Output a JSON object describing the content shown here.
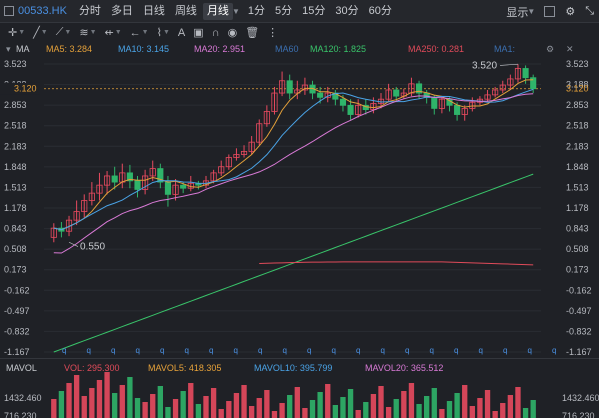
{
  "topbar": {
    "code": "00533.HK",
    "tabs": [
      "分时",
      "多日",
      "日线",
      "周线",
      "月线",
      "1分",
      "5分",
      "15分",
      "30分",
      "60分"
    ],
    "active_tab": "月线",
    "display_label": "显示"
  },
  "ma_legend": {
    "label": "MA",
    "items": [
      {
        "text": "MA5: 3.284",
        "color": "#e3a03a"
      },
      {
        "text": "MA10: 3.145",
        "color": "#4aa3e6"
      },
      {
        "text": "MA20: 2.951",
        "color": "#d97ad6"
      },
      {
        "text": "MA60",
        "color": "#3b6fb0"
      },
      {
        "text": "MA120: 1.825",
        "color": "#39c46a"
      },
      {
        "text": "MA250: 0.281",
        "color": "#e04b5a"
      },
      {
        "text": "MA1:",
        "color": "#3b6fb0"
      }
    ]
  },
  "price_axis": {
    "ticks": [
      "3.523",
      "3.188",
      "2.853",
      "2.518",
      "2.183",
      "1.848",
      "1.513",
      "1.178",
      "0.843",
      "0.508",
      "0.173",
      "-0.162",
      "-0.497",
      "-0.832",
      "-1.167"
    ],
    "current_price": "3.120",
    "high_label": "3.520",
    "low_label": "0.550",
    "colors": {
      "up": "#e84a5f",
      "down": "#2fb46a",
      "current": "#e8a33a"
    }
  },
  "vol_legend": {
    "label": "MAVOL",
    "items": [
      {
        "text": "VOL: 295.300",
        "color": "#e04b5a"
      },
      {
        "text": "MAVOL5: 418.305",
        "color": "#e8a33a"
      },
      {
        "text": "MAVOL10: 395.799",
        "color": "#4aa3e6"
      },
      {
        "text": "MAVOL20: 365.512",
        "color": "#d97ad6"
      }
    ],
    "axis_ticks": [
      "1432.460",
      "716.230"
    ]
  },
  "chart_data": {
    "type": "candlestick",
    "ylim": [
      -1.167,
      3.523
    ],
    "candles": [
      [
        0.7,
        0.85,
        0.93,
        0.62
      ],
      [
        0.85,
        0.8,
        0.95,
        0.7
      ],
      [
        0.8,
        0.98,
        1.05,
        0.72
      ],
      [
        0.98,
        1.12,
        1.3,
        0.9
      ],
      [
        1.12,
        1.3,
        1.4,
        1.02
      ],
      [
        1.3,
        1.42,
        1.6,
        1.22
      ],
      [
        1.42,
        1.55,
        1.75,
        1.3
      ],
      [
        1.55,
        1.7,
        1.78,
        1.4
      ],
      [
        1.7,
        1.6,
        1.85,
        1.48
      ],
      [
        1.6,
        1.75,
        1.9,
        1.5
      ],
      [
        1.75,
        1.62,
        1.88,
        1.5
      ],
      [
        1.62,
        1.48,
        1.7,
        1.35
      ],
      [
        1.48,
        1.7,
        1.8,
        1.4
      ],
      [
        1.7,
        1.82,
        1.95,
        1.62
      ],
      [
        1.82,
        1.6,
        1.9,
        1.5
      ],
      [
        1.6,
        1.4,
        1.7,
        1.2
      ],
      [
        1.4,
        1.55,
        1.65,
        1.3
      ],
      [
        1.55,
        1.5,
        1.6,
        1.42
      ],
      [
        1.5,
        1.58,
        1.7,
        1.45
      ],
      [
        1.58,
        1.55,
        1.62,
        1.48
      ],
      [
        1.55,
        1.62,
        1.7,
        1.5
      ],
      [
        1.62,
        1.75,
        1.8,
        1.58
      ],
      [
        1.75,
        1.85,
        1.95,
        1.7
      ],
      [
        1.85,
        2.0,
        2.05,
        1.8
      ],
      [
        2.0,
        2.05,
        2.15,
        1.95
      ],
      [
        2.05,
        2.1,
        2.2,
        2.0
      ],
      [
        2.1,
        2.25,
        2.35,
        2.05
      ],
      [
        2.25,
        2.55,
        2.62,
        2.2
      ],
      [
        2.55,
        2.75,
        2.85,
        2.5
      ],
      [
        2.75,
        3.05,
        3.15,
        2.7
      ],
      [
        3.05,
        3.25,
        3.4,
        3.0
      ],
      [
        3.25,
        3.05,
        3.35,
        2.95
      ],
      [
        3.05,
        3.1,
        3.25,
        2.95
      ],
      [
        3.1,
        3.18,
        3.3,
        3.02
      ],
      [
        3.18,
        3.05,
        3.25,
        2.95
      ],
      [
        3.05,
        2.98,
        3.15,
        2.88
      ],
      [
        2.98,
        3.05,
        3.15,
        2.9
      ],
      [
        3.05,
        2.95,
        3.1,
        2.85
      ],
      [
        2.95,
        2.85,
        3.02,
        2.75
      ],
      [
        2.85,
        2.7,
        2.95,
        2.6
      ],
      [
        2.7,
        2.85,
        2.95,
        2.65
      ],
      [
        2.85,
        2.78,
        2.95,
        2.7
      ],
      [
        2.78,
        2.88,
        2.98,
        2.72
      ],
      [
        2.88,
        2.95,
        3.05,
        2.8
      ],
      [
        2.95,
        3.1,
        3.2,
        2.9
      ],
      [
        3.1,
        3.0,
        3.15,
        2.92
      ],
      [
        3.0,
        3.05,
        3.12,
        2.95
      ],
      [
        3.05,
        3.2,
        3.3,
        3.0
      ],
      [
        3.2,
        3.05,
        3.25,
        2.95
      ],
      [
        3.05,
        2.98,
        3.1,
        2.88
      ],
      [
        2.98,
        2.8,
        3.02,
        2.7
      ],
      [
        2.8,
        2.95,
        3.0,
        2.72
      ],
      [
        2.95,
        2.85,
        2.98,
        2.75
      ],
      [
        2.85,
        2.7,
        2.9,
        2.6
      ],
      [
        2.7,
        2.8,
        2.85,
        2.6
      ],
      [
        2.8,
        2.9,
        2.98,
        2.75
      ],
      [
        2.9,
        2.95,
        3.0,
        2.85
      ],
      [
        2.95,
        3.02,
        3.1,
        2.9
      ],
      [
        3.02,
        3.1,
        3.15,
        2.98
      ],
      [
        3.1,
        3.18,
        3.25,
        3.05
      ],
      [
        3.18,
        3.28,
        3.35,
        3.1
      ],
      [
        3.28,
        3.45,
        3.52,
        3.22
      ],
      [
        3.45,
        3.3,
        3.5,
        3.2
      ],
      [
        3.3,
        3.12,
        3.35,
        3.05
      ]
    ]
  }
}
